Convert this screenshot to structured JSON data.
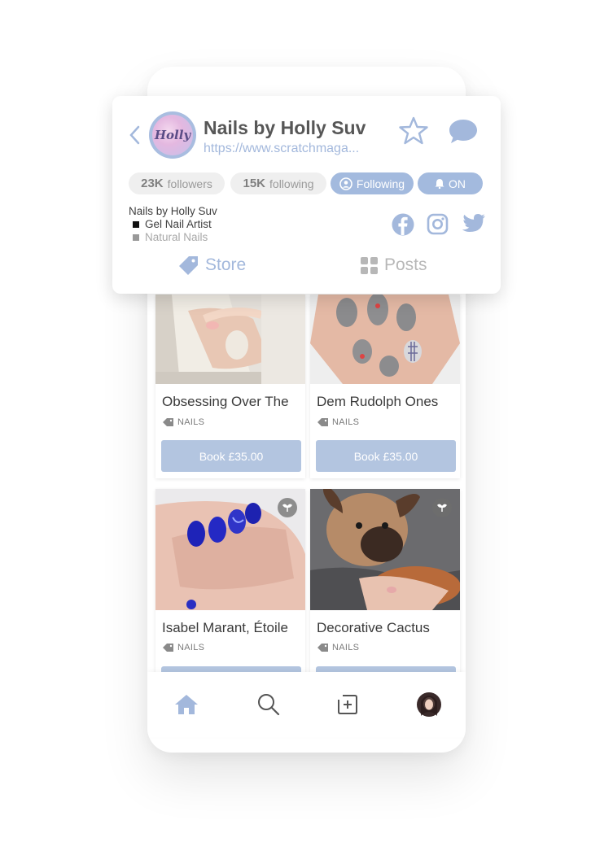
{
  "profile": {
    "name": "Nails by Holly Suv",
    "url": "https://www.scratchmaga...",
    "avatar_text": "Holly",
    "followers_count": "23K",
    "followers_label": "followers",
    "following_count": "15K",
    "following_label": "following",
    "following_button": "Following",
    "notify_button": "ON",
    "bio": {
      "line1": "Nails by Holly Suv",
      "line2": "Gel Nail Artist",
      "line3": "Natural Nails"
    }
  },
  "tabs": [
    {
      "label": "Store",
      "icon": "tag-icon",
      "active": true
    },
    {
      "label": "Posts",
      "icon": "grid-icon",
      "active": false
    }
  ],
  "products": [
    {
      "title": "Obsessing Over The",
      "tag": "NAILS",
      "button": "Book £35.00"
    },
    {
      "title": "Dem Rudolph Ones",
      "tag": "NAILS",
      "button": "Book £35.00"
    },
    {
      "title": "Isabel Marant, Étoile",
      "tag": "NAILS",
      "button": ""
    },
    {
      "title": "Decorative Cactus",
      "tag": "NAILS",
      "button": ""
    }
  ],
  "colors": {
    "accent": "#a3b8dc",
    "button": "#b3c5e0",
    "text": "#575757"
  },
  "nav": [
    "home-icon",
    "search-icon",
    "add-post-icon",
    "profile-avatar"
  ]
}
